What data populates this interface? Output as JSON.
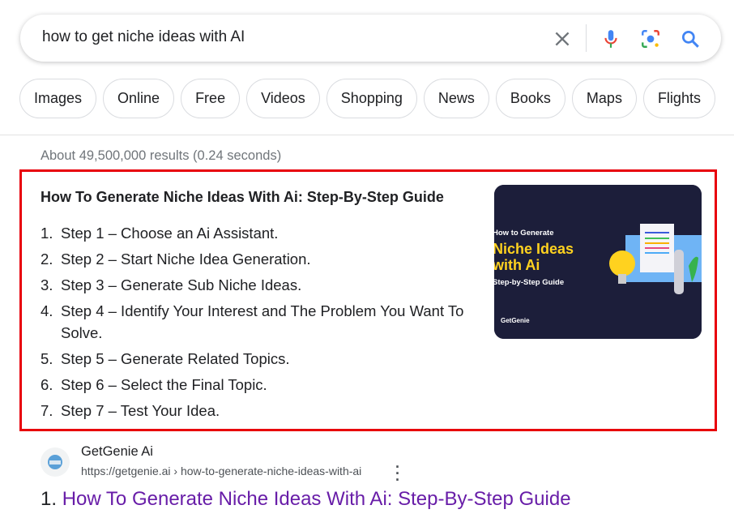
{
  "search": {
    "query": "how to get niche ideas with AI",
    "icons": [
      "clear-icon",
      "microphone-icon",
      "lens-icon",
      "search-icon"
    ]
  },
  "chips": [
    "Images",
    "Online",
    "Free",
    "Videos",
    "Shopping",
    "News",
    "Books",
    "Maps",
    "Flights"
  ],
  "stats": "About 49,500,000 results (0.24 seconds)",
  "snippet": {
    "title": "How To Generate Niche Ideas With Ai: Step-By-Step Guide",
    "highlight_color": "#e8000b",
    "steps": [
      "Step 1 – Choose an Ai Assistant.",
      "Step 2 – Start Niche Idea Generation.",
      "Step 3 – Generate Sub Niche Ideas.",
      "Step 4 – Identify Your Interest and The Problem You Want To Solve.",
      "Step 5 – Generate Related Topics.",
      "Step 6 – Select the Final Topic.",
      "Step 7 – Test Your Idea."
    ],
    "image": {
      "line1": "How to Generate",
      "line2": "Niche Ideas",
      "line3": "with Ai",
      "line4": "Step-by-Step Guide",
      "brand": "GetGenie"
    }
  },
  "result": {
    "site_name": "GetGenie Ai",
    "url": "https://getgenie.ai › how-to-generate-niche-ideas-with-ai",
    "number": "1.",
    "title": "How To Generate Niche Ideas With Ai: Step-By-Step Guide",
    "link_color": "#681da8"
  }
}
